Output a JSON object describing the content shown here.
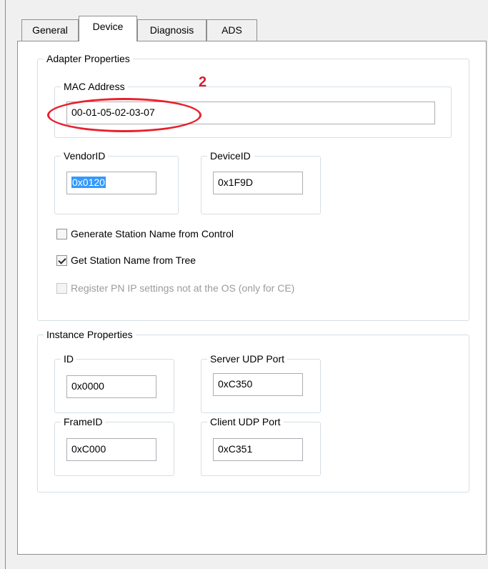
{
  "tabs": [
    "General",
    "Device",
    "Diagnosis",
    "ADS"
  ],
  "adapter": {
    "title": "Adapter Properties",
    "mac": {
      "label": "MAC Address",
      "value": "00-01-05-02-03-07"
    },
    "vendor": {
      "label": "VendorID",
      "value": "0x0120"
    },
    "device": {
      "label": "DeviceID",
      "value": "0x1F9D"
    },
    "checks": [
      {
        "label": "Generate Station Name from Control",
        "checked": false,
        "enabled": true
      },
      {
        "label": "Get Station Name from Tree",
        "checked": true,
        "enabled": true
      },
      {
        "label": "Register PN IP settings not at the OS (only for CE)",
        "checked": false,
        "enabled": false
      }
    ]
  },
  "instance": {
    "title": "Instance Properties",
    "id": {
      "label": "ID",
      "value": "0x0000"
    },
    "server_port": {
      "label": "Server UDP Port",
      "value": "0xC350"
    },
    "frame_id": {
      "label": "FrameID",
      "value": "0xC000"
    },
    "client_port": {
      "label": "Client UDP Port",
      "value": "0xC351"
    }
  },
  "annotation": {
    "number": "2",
    "color": "#e8212d"
  }
}
